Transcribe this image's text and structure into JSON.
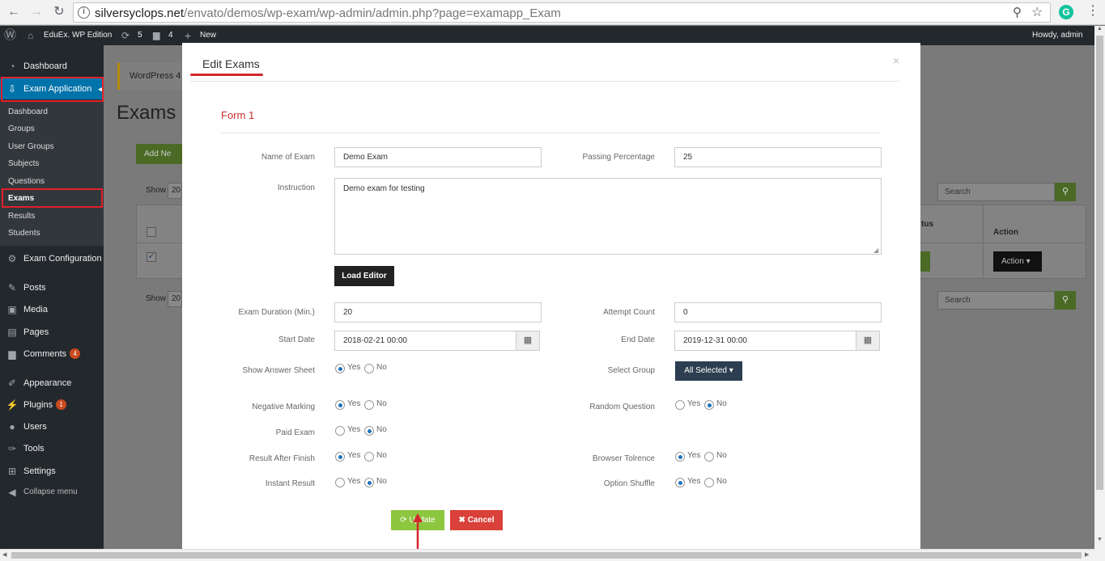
{
  "browser": {
    "url_host": "silversyclops.net",
    "url_path": "/envato/demos/wp-exam/wp-admin/admin.php?page=examapp_Exam",
    "ext_letter": "G"
  },
  "adminbar": {
    "site_name": "EduEx. WP Edition",
    "updates_count": "5",
    "comments_count": "4",
    "new_label": "New",
    "howdy": "Howdy, admin"
  },
  "sidebar": {
    "dashboard": "Dashboard",
    "exam_application": "Exam Application",
    "submenu": [
      "Dashboard",
      "Groups",
      "User Groups",
      "Subjects",
      "Questions",
      "Exams",
      "Results",
      "Students"
    ],
    "exam_configuration": "Exam Configuration",
    "posts": "Posts",
    "media": "Media",
    "pages": "Pages",
    "comments": "Comments",
    "comments_badge": "4",
    "appearance": "Appearance",
    "plugins": "Plugins",
    "plugins_badge": "1",
    "users": "Users",
    "tools": "Tools",
    "settings": "Settings",
    "collapse": "Collapse menu"
  },
  "background": {
    "notice": "WordPress 4",
    "page_title": "Exams",
    "add_new": "Add Ne",
    "show_label": "Show",
    "show_value": "20",
    "search_placeholder": "Search",
    "col_status": "tus",
    "col_action": "Action",
    "action_button": "Action"
  },
  "modal": {
    "title": "Edit Exams",
    "form_title": "Form 1",
    "labels": {
      "name_of_exam": "Name of Exam",
      "passing_percentage": "Passing Percentage",
      "instruction": "Instruction",
      "exam_duration": "Exam Duration (Min.)",
      "attempt_count": "Attempt Count",
      "start_date": "Start Date",
      "end_date": "End Date",
      "show_answer_sheet": "Show Answer Sheet",
      "select_group": "Select Group",
      "negative_marking": "Negative Marking",
      "random_question": "Random Question",
      "paid_exam": "Paid Exam",
      "result_after_finish": "Result After Finish",
      "browser_tolrence": "Browser Tolrence",
      "instant_result": "Instant Result",
      "option_shuffle": "Option Shuffle"
    },
    "values": {
      "name_of_exam": "Demo Exam",
      "passing_percentage": "25",
      "instruction": "Demo exam for testing",
      "exam_duration": "20",
      "attempt_count": "0",
      "start_date": "2018-02-21 00:00",
      "end_date": "2019-12-31 00:00",
      "select_group": "All Selected"
    },
    "radio_yes": "Yes",
    "radio_no": "No",
    "load_editor": "Load Editor",
    "update": "Update",
    "cancel": "Cancel",
    "close_glyph": "×"
  },
  "colors": {
    "accent_red": "#d3262d",
    "wp_blue": "#0073aa",
    "update_green": "#8dc63f",
    "cancel_red": "#d9413a",
    "admin_dark": "#23282d"
  }
}
